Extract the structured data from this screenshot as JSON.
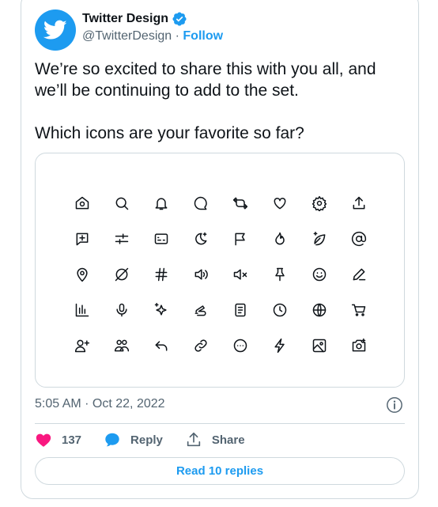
{
  "author": {
    "name": "Twitter Design",
    "handle": "@TwitterDesign",
    "separator": "·",
    "follow_label": "Follow",
    "verified": true
  },
  "tweet": {
    "line1": "We’re so excited to share this with you all, and we’ll be continuing to add to the set.",
    "line2": "Which icons are your favorite so far?"
  },
  "media": {
    "icons": [
      [
        "home-icon",
        "search-icon",
        "notification-bell-icon",
        "message-bubble-icon",
        "retweet-icon",
        "heart-icon",
        "settings-gear-icon",
        "upload-share-icon"
      ],
      [
        "add-message-icon",
        "sliders-filter-icon",
        "card-id-icon",
        "moon-sparkle-icon",
        "flag-icon",
        "flame-icon",
        "leaf-sparkle-icon",
        "at-sign-icon"
      ],
      [
        "location-pin-icon",
        "hidden-slash-icon",
        "hashtag-icon",
        "volume-on-icon",
        "volume-mute-icon",
        "pin-icon",
        "smiley-icon",
        "pencil-edit-icon"
      ],
      [
        "analytics-bars-icon",
        "microphone-icon",
        "sparkles-icon",
        "hand-wave-icon",
        "document-list-icon",
        "clock-icon",
        "globe-icon",
        "shopping-cart-icon"
      ],
      [
        "add-user-icon",
        "people-community-icon",
        "reply-arrow-icon",
        "link-icon",
        "more-circle-icon",
        "lightning-icon",
        "image-icon",
        "camera-add-icon"
      ]
    ]
  },
  "meta": {
    "timestamp": "5:05 AM · Oct 22, 2022"
  },
  "actions": {
    "like_count": "137",
    "reply_label": "Reply",
    "share_label": "Share",
    "read_replies_label": "Read 10 replies"
  },
  "colors": {
    "accent": "#1d9bf0",
    "like": "#f91880",
    "text": "#0f1419",
    "secondary": "#536471",
    "border": "#cfd9de"
  }
}
